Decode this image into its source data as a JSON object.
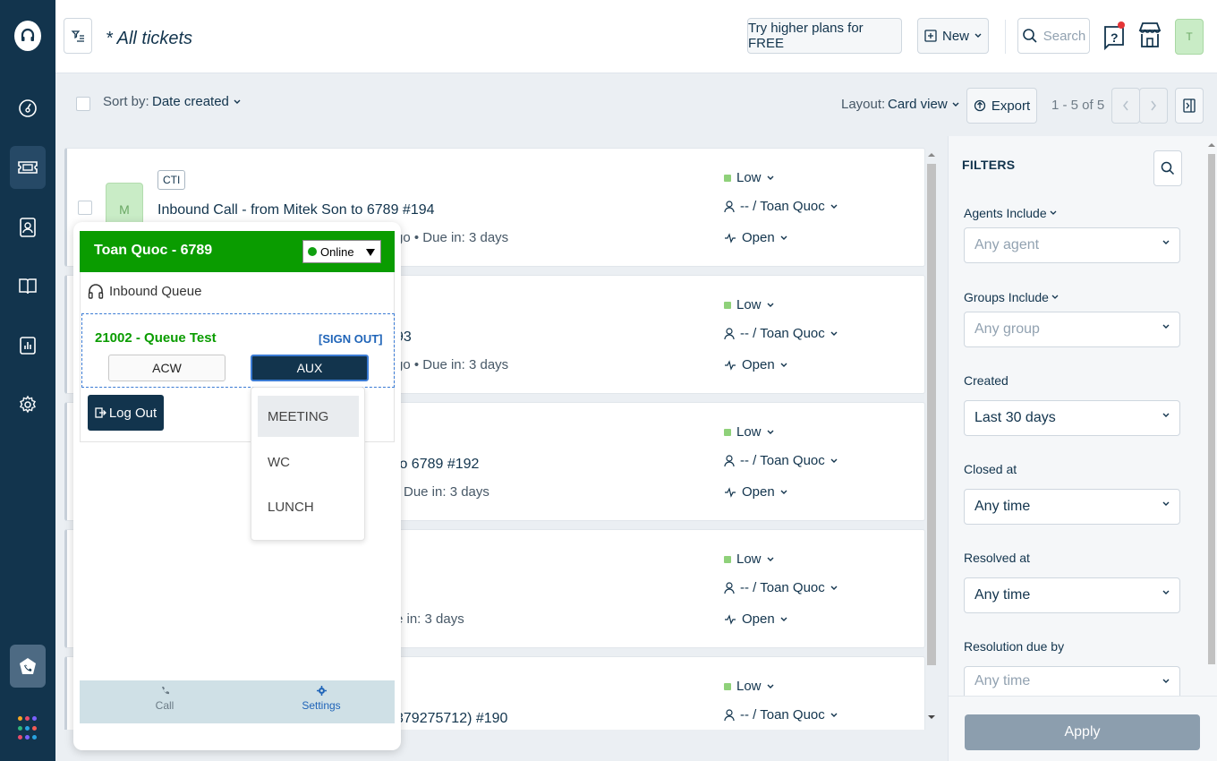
{
  "header": {
    "title": "* All tickets",
    "upgrade_label": "Try higher plans for FREE",
    "new_label": "New",
    "search_placeholder": "Search",
    "avatar_initial": "T"
  },
  "toolbar": {
    "sort_label": "Sort by:",
    "sort_value": "Date created",
    "layout_label": "Layout:",
    "layout_value": "Card view",
    "export_label": "Export",
    "pagination": "1 - 5 of 5"
  },
  "tickets": [
    {
      "tag": "CTI",
      "avatar": "M",
      "subject": "Inbound Call - from Mitek Son to 6789 #194",
      "meta": "go  •  Due in: 3 days",
      "priority": "Low",
      "assignee": "-- / Toan Quoc",
      "status": "Open"
    },
    {
      "subject": "93",
      "meta": "go  •  Due in: 3 days",
      "priority": "Low",
      "assignee": "-- / Toan Quoc",
      "status": "Open"
    },
    {
      "subject": "to 6789 #192",
      "meta": "Due in: 3 days",
      "priority": "Low",
      "assignee": "-- / Toan Quoc",
      "status": "Open"
    },
    {
      "subject": "",
      "meta": "e in: 3 days",
      "priority": "Low",
      "assignee": "-- / Toan Quoc",
      "status": "Open"
    },
    {
      "subject": "379275712) #190",
      "meta": "",
      "priority": "Low",
      "assignee": "-- / Toan Quoc",
      "status": "Open"
    }
  ],
  "filters": {
    "title": "FILTERS",
    "agents_label": "Agents Include",
    "agents_placeholder": "Any agent",
    "groups_label": "Groups Include",
    "groups_placeholder": "Any group",
    "created_label": "Created",
    "created_value": "Last 30 days",
    "closed_label": "Closed at",
    "closed_value": "Any time",
    "resolved_label": "Resolved at",
    "resolved_value": "Any time",
    "resolution_due_label": "Resolution due by",
    "resolution_due_placeholder": "Any time",
    "apply_label": "Apply"
  },
  "softphone": {
    "agent_name": "Toan Quoc - 6789",
    "status": "Online",
    "queue_label": "Inbound Queue",
    "queue_name": "21002 - Queue Test",
    "signout_label": "[SIGN OUT]",
    "acw_label": "ACW",
    "aux_label": "AUX",
    "logout_label": "Log Out",
    "aux_options": [
      "MEETING",
      "WC",
      "LUNCH"
    ],
    "tab_call": "Call",
    "tab_settings": "Settings"
  },
  "colors": {
    "sidebar": "#12344d",
    "softphone_header": "#0a9c00",
    "priority_low": "#8fd17a",
    "apply_disabled": "#8c9eae"
  }
}
